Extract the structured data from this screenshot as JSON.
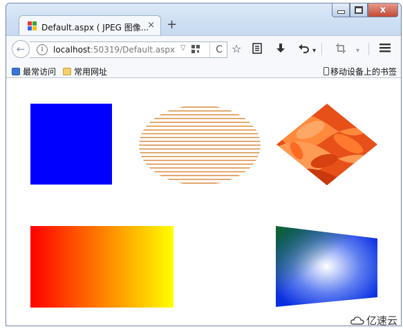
{
  "tab": {
    "title": "Default.aspx ( JPEG 图像...",
    "close": "×"
  },
  "new_tab": "+",
  "window_controls": {
    "close": "x"
  },
  "urlbar": {
    "info": "i",
    "host": "localhost",
    "rest": ":50319/Default.aspx",
    "dropdown": "▽",
    "reload": "C"
  },
  "bookmarks": {
    "most_visited": "最常访问",
    "common_sites": "常用网址",
    "mobile": "移动设备上的书签"
  },
  "watermark": {
    "text": "亿速云"
  },
  "shapes": {
    "square_color": "#0000ff",
    "ellipse_line_color": "#d98a3e",
    "gradient_rect": [
      "#ff0000",
      "#ffff00"
    ],
    "quad_gradient": [
      "#ffffff",
      "#0a2fe0",
      "#0f6b1a"
    ],
    "diamond_texture": [
      "#ff7a2e",
      "#d6420f",
      "#ff9b55"
    ]
  },
  "icons": [
    "back-arrow-icon",
    "info-icon",
    "qr-code-icon",
    "reload-icon",
    "star-icon",
    "reading-list-icon",
    "download-icon",
    "undo-icon",
    "crop-icon",
    "menu-icon",
    "bookmark-icon",
    "folder-icon",
    "mobile-device-icon"
  ]
}
